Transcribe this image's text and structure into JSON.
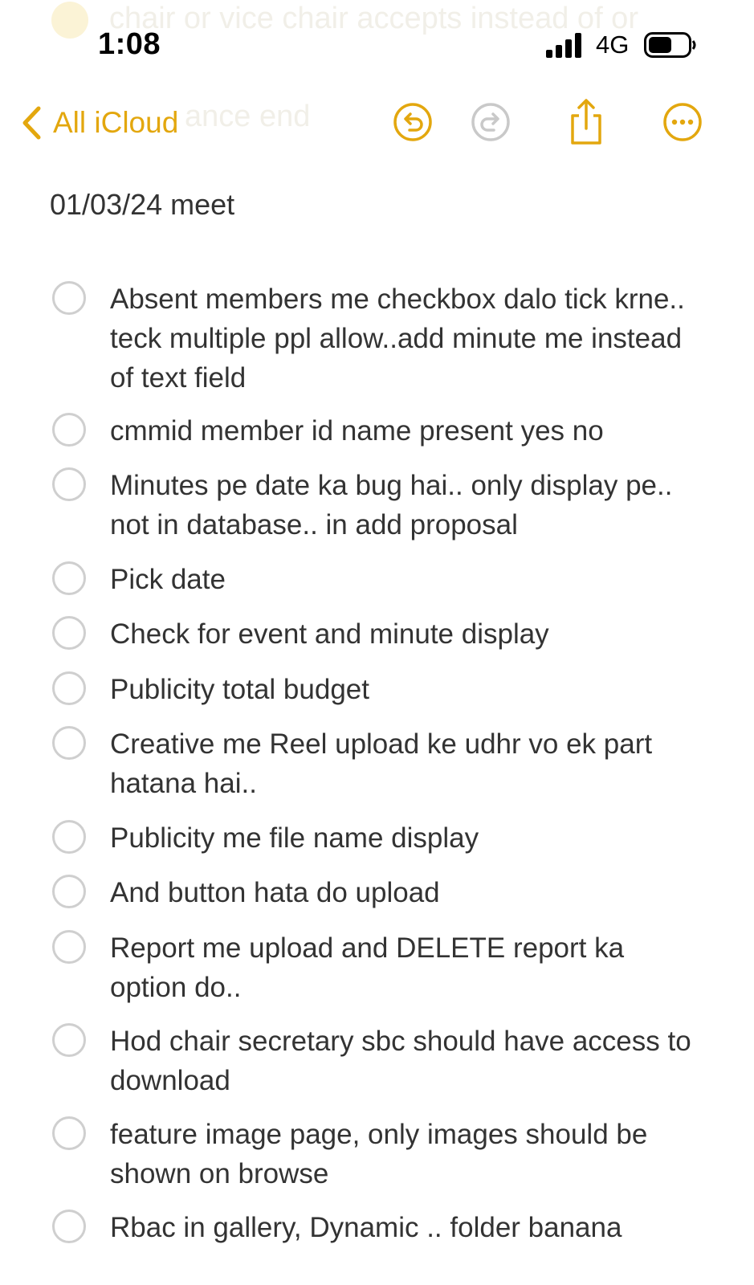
{
  "status_bar": {
    "time": "1:08",
    "network": "4G",
    "signal_icon": "cellular-signal-icon",
    "battery_icon": "battery-icon"
  },
  "toolbar": {
    "back_label": "All iCloud",
    "back_icon": "chevron-left-icon",
    "undo_icon": "undo-icon",
    "redo_icon": "redo-icon",
    "share_icon": "share-icon",
    "more_icon": "more-icon",
    "accent_color": "#e3a70e"
  },
  "background_ghost": {
    "line1": "chair or vice chair accepts instead of or",
    "line2": "ance end"
  },
  "note": {
    "title": "01/03/24 meet",
    "items": [
      {
        "text": "Absent members me checkbox dalo  tick krne.. teck multiple ppl allow..add minute me instead of text field",
        "checked": false
      },
      {
        "text": "cmmid member id name present yes no",
        "checked": false
      },
      {
        "text": "Minutes pe date ka bug hai.. only display pe.. not in database.. in add proposal",
        "checked": false
      },
      {
        "text": "Pick date",
        "checked": false
      },
      {
        "text": "Check for event and minute display",
        "checked": false
      },
      {
        "text": "Publicity total budget",
        "checked": false
      },
      {
        "text": "Creative me Reel upload ke udhr vo ek part hatana hai..",
        "checked": false
      },
      {
        "text": "Publicity me file name display",
        "checked": false
      },
      {
        "text": "And button hata do upload",
        "checked": false
      },
      {
        "text": "Report me upload and DELETE report ka option do..",
        "checked": false
      },
      {
        "text": "Hod chair secretary sbc should have access to download",
        "checked": false
      },
      {
        "text": "feature image page, only images should be shown on browse",
        "checked": false
      },
      {
        "text": "Rbac in gallery, Dynamic .. folder banana",
        "checked": false
      }
    ]
  }
}
